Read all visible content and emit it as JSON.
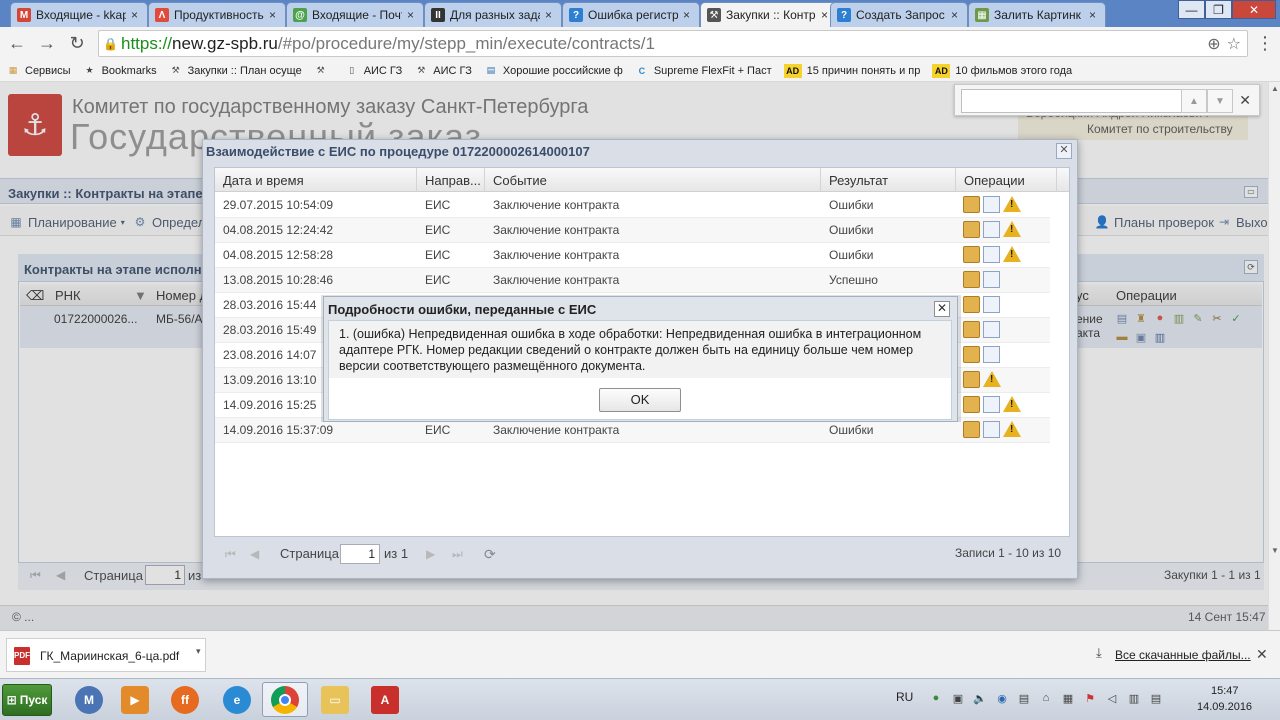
{
  "browser": {
    "tabs": [
      {
        "title": "Входящие - kkap",
        "fav": "M",
        "favColor": "#d44638"
      },
      {
        "title": "Продуктивность",
        "fav": "Λ",
        "favColor": "#e04b3c"
      },
      {
        "title": "Входящие - Почт",
        "fav": "@",
        "favColor": "#4aa34a"
      },
      {
        "title": "Для разных зада",
        "fav": "II",
        "favColor": "#333333"
      },
      {
        "title": "Ошибка регистр",
        "fav": "?",
        "favColor": "#2f7fd0"
      },
      {
        "title": "Закупки :: Контр",
        "fav": "⚒",
        "favColor": "#555555"
      },
      {
        "title": "Создать Запрос",
        "fav": "?",
        "favColor": "#2f7fd0"
      },
      {
        "title": "Залить Картинк",
        "fav": "▦",
        "favColor": "#6c9a4a"
      }
    ],
    "active_tab": 5,
    "url_scheme": "https://",
    "url_host": "new.gz-spb.ru",
    "url_path": "/#po/procedure/my/stepp_min/execute/contracts/1",
    "bookmarks": [
      {
        "label": "Сервисы",
        "icon": "apps-icon"
      },
      {
        "label": "Bookmarks",
        "icon": "star-icon"
      },
      {
        "label": "Закупки :: План осуще",
        "icon": "hammer-icon"
      },
      {
        "label": "",
        "icon": "hammer-icon"
      },
      {
        "label": "АИС ГЗ",
        "icon": "page-icon"
      },
      {
        "label": "АИС ГЗ",
        "icon": "hammer-icon"
      },
      {
        "label": "Хорошие российские ф",
        "icon": "calendar-icon"
      },
      {
        "label": "Supreme FlexFit + Паст",
        "icon": "c-icon"
      },
      {
        "label": "15 причин понять и пр",
        "icon": "ad-icon"
      },
      {
        "label": "10 фильмов этого года",
        "icon": "ad-icon"
      }
    ]
  },
  "site": {
    "org_line1": "Комитет по государственному заказу Санкт-Петербурга",
    "org_line2": "Государственный заказ",
    "user_name": "Воробицкий Андрей Николаевич",
    "user_org": "Комитет по строительству",
    "section_title": "Закупки :: Контракты на этапе исполнения",
    "menu": {
      "planning": "Планирование",
      "define": "Определ",
      "inspections": "Планы проверок",
      "exit": "Выхо"
    },
    "panel_title": "Контракты на этапе исполнения",
    "columns": {
      "rnk": "РНК",
      "number": "Номер д",
      "status": "ус",
      "operations": "Операции"
    },
    "row": {
      "rnk": "01722000026...",
      "number": "МБ-56/А",
      "status1": "ение",
      "status2": "акта"
    },
    "pager": {
      "page_label": "Страница",
      "page": "1",
      "of": "из",
      "summary": "Закупки 1 - 1 из 1"
    },
    "footer_left": "© ...",
    "footer_right": "14 Сент 15:47"
  },
  "eis": {
    "title": "Взаимодействие с ЕИС по процедуре 0172200002614000107",
    "columns": [
      "Дата и время",
      "Направ...",
      "Событие",
      "Результат",
      "Операции"
    ],
    "rows": [
      {
        "date": "29.07.2015 10:54:09",
        "dir": "ЕИС",
        "event": "Заключение контракта",
        "result": "Ошибки",
        "ops": [
          "box",
          "doc",
          "warn"
        ]
      },
      {
        "date": "04.08.2015 12:24:42",
        "dir": "ЕИС",
        "event": "Заключение контракта",
        "result": "Ошибки",
        "ops": [
          "box",
          "doc",
          "warn"
        ]
      },
      {
        "date": "04.08.2015 12:58:28",
        "dir": "ЕИС",
        "event": "Заключение контракта",
        "result": "Ошибки",
        "ops": [
          "box",
          "doc",
          "warn"
        ]
      },
      {
        "date": "13.08.2015 10:28:46",
        "dir": "ЕИС",
        "event": "Заключение контракта",
        "result": "Успешно",
        "ops": [
          "box",
          "doc"
        ]
      },
      {
        "date": "28.03.2016 15:44",
        "dir": "",
        "event": "",
        "result": "",
        "ops": [
          "box",
          "doc"
        ]
      },
      {
        "date": "28.03.2016 15:49",
        "dir": "",
        "event": "",
        "result": "",
        "ops": [
          "box",
          "doc"
        ]
      },
      {
        "date": "23.08.2016 14:07",
        "dir": "",
        "event": "",
        "result": "",
        "ops": [
          "box",
          "doc"
        ]
      },
      {
        "date": "13.09.2016 13:10",
        "dir": "",
        "event": "",
        "result": "",
        "ops": [
          "box",
          "warn"
        ]
      },
      {
        "date": "14.09.2016 15:25",
        "dir": "",
        "event": "",
        "result": "",
        "ops": [
          "box",
          "doc",
          "warn"
        ]
      },
      {
        "date": "14.09.2016 15:37:09",
        "dir": "ЕИС",
        "event": "Заключение контракта",
        "result": "Ошибки",
        "ops": [
          "box",
          "doc",
          "warn"
        ]
      }
    ],
    "pager": {
      "page_label": "Страница",
      "page": "1",
      "of": "из 1",
      "summary": "Записи 1 - 10 из 10"
    }
  },
  "error_dialog": {
    "title": "Подробности ошибки, переданные с ЕИС",
    "message": "1. (ошибка) Непредвиденная ошибка в ходе обработки: Непредвиденная ошибка в интеграционном адаптере РГК. Номер редакции сведений о контракте должен быть на единицу больше чем номер версии соответствующего размещённого документа.",
    "ok_label": "OK"
  },
  "downloads": {
    "file_name": "ГК_Мариинская_6-ца.pdf",
    "show_all": "Все скачанные файлы..."
  },
  "taskbar": {
    "start_label": "Пуск",
    "lang": "RU",
    "time": "15:47",
    "date": "14.09.2016"
  }
}
